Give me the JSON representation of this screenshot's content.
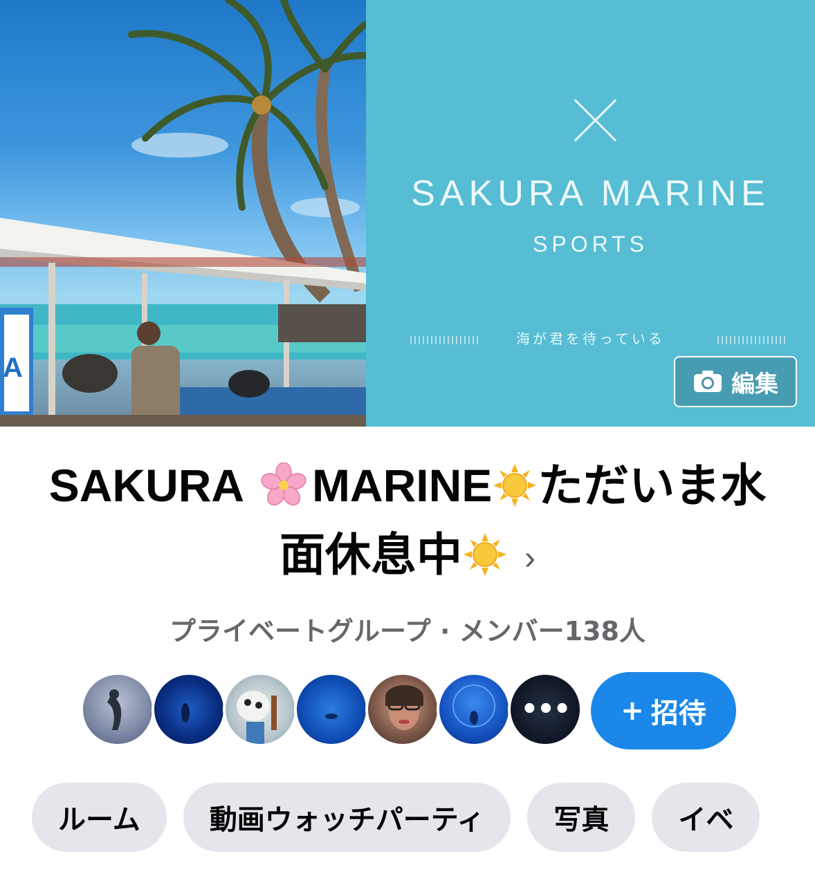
{
  "cover": {
    "brand_name": "SAKURA MARINE",
    "brand_sub": "SPORTS",
    "tagline": "海が君を待っている",
    "edit_label": "編集"
  },
  "group": {
    "name_part1": "SAKURA",
    "name_part2": "MARINE",
    "name_part3": "ただいま水面休息中",
    "chevron": "›",
    "meta": "プライベートグループ · メンバー138人"
  },
  "members": {
    "more_label": "•••",
    "invite_label": "招待",
    "invite_icon": "+"
  },
  "tabs": [
    {
      "label": "ルーム"
    },
    {
      "label": "動画ウォッチパーティ"
    },
    {
      "label": "写真"
    },
    {
      "label": "イベ"
    }
  ],
  "colors": {
    "brand_bg": "#56bdd4",
    "invite_bg": "#1b87e8",
    "tab_bg": "#e4e6eb",
    "meta_text": "#65676b"
  }
}
